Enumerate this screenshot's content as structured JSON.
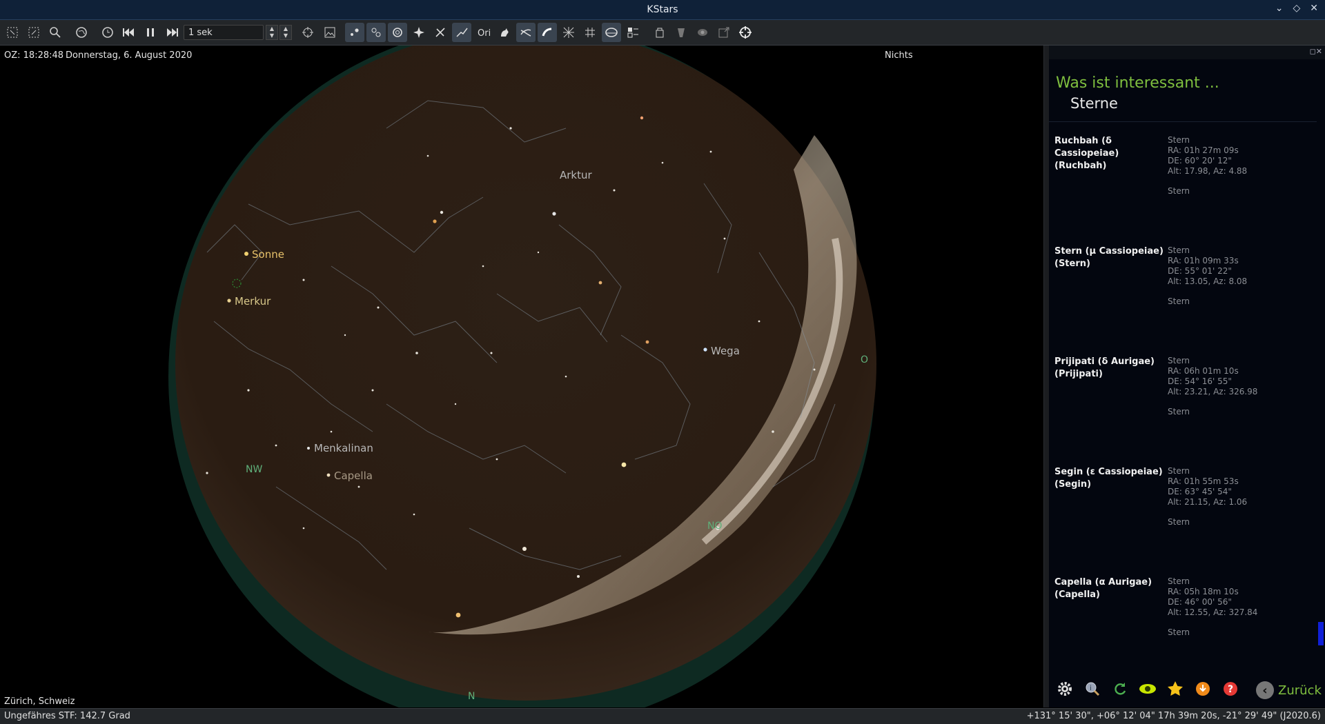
{
  "window": {
    "title": "KStars"
  },
  "toolbar": {
    "speed_value": "1 sek",
    "icons": [
      "zoom-fit-icon",
      "zoom-select-icon",
      "search-icon",
      "globe-icon",
      "clock-icon",
      "skip-back-icon",
      "pause-icon",
      "skip-forward-icon",
      "stars-icon",
      "deep-sky-icon",
      "planets-icon",
      "comets-icon",
      "satellites-icon",
      "constellation-lines-icon",
      "constellation-names-icon",
      "milky-way-icon",
      "grid-icon",
      "ground-icon",
      "flags-icon",
      "hips-icon",
      "fov-icon",
      "eyepiece-icon",
      "observing-icon",
      "cursor-icon",
      "crosshair-icon"
    ]
  },
  "sky": {
    "time_label": "OZ: 18:28:48",
    "date_label": "Donnerstag, 6. August 2020",
    "focus_label": "Nichts",
    "location_label": "Zürich, Schweiz",
    "object_labels": {
      "arktur": "Arktur",
      "sonne": "Sonne",
      "merkur": "Merkur",
      "wega": "Wega",
      "menkalinan": "Menkalinan",
      "capella": "Capella"
    },
    "compass": {
      "nw": "NW",
      "no": "NO",
      "n": "N",
      "o": "O"
    },
    "colors": {
      "background": "#000000",
      "sky_disk": "#2a1d13",
      "ground": "#0e2a22",
      "labels": "#b8b8b8",
      "sun_label": "#e8c26a",
      "compass": "#5fb07a"
    }
  },
  "panel": {
    "title": "Was ist interessant ...",
    "subtitle": "Sterne",
    "objects": [
      {
        "name": "Ruchbah (δ Cassiopeiae)\n(Ruchbah)",
        "type": "Stern",
        "ra": "RA: 01h 27m 09s",
        "de": "DE: 60° 20' 12\"",
        "alt_az": "Alt: 17.98, Az: 4.88",
        "type2": "Stern"
      },
      {
        "name": "Stern (μ Cassiopeiae)\n(Stern)",
        "type": "Stern",
        "ra": "RA: 01h 09m 33s",
        "de": "DE: 55° 01' 22\"",
        "alt_az": "Alt: 13.05, Az: 8.08",
        "type2": "Stern"
      },
      {
        "name": "Prijipati (δ Aurigae)\n(Prijipati)",
        "type": "Stern",
        "ra": "RA: 06h 01m 10s",
        "de": "DE: 54° 16' 55\"",
        "alt_az": "Alt: 23.21, Az: 326.98",
        "type2": "Stern"
      },
      {
        "name": "Segin (ε Cassiopeiae)\n(Segin)",
        "type": "Stern",
        "ra": "RA: 01h 55m 53s",
        "de": "DE: 63° 45' 54\"",
        "alt_az": "Alt: 21.15, Az: 1.06",
        "type2": "Stern"
      },
      {
        "name": "Capella (α Aurigae)\n(Capella)",
        "type": "Stern",
        "ra": "RA: 05h 18m 10s",
        "de": "DE: 46° 00' 56\"",
        "alt_az": "Alt: 12.55, Az: 327.84",
        "type2": "Stern"
      }
    ],
    "back_label": "Zurück",
    "bottom_icons": [
      "settings-icon",
      "inspect-icon",
      "reload-icon",
      "visibility-icon",
      "favorite-icon",
      "download-icon",
      "help-icon"
    ]
  },
  "status": {
    "left": "Ungefähres STF: 142.7 Grad",
    "right": "+131° 15' 30\", +06° 12' 04\"  17h 39m 20s, -21° 29' 49\" (J2020.6)"
  }
}
